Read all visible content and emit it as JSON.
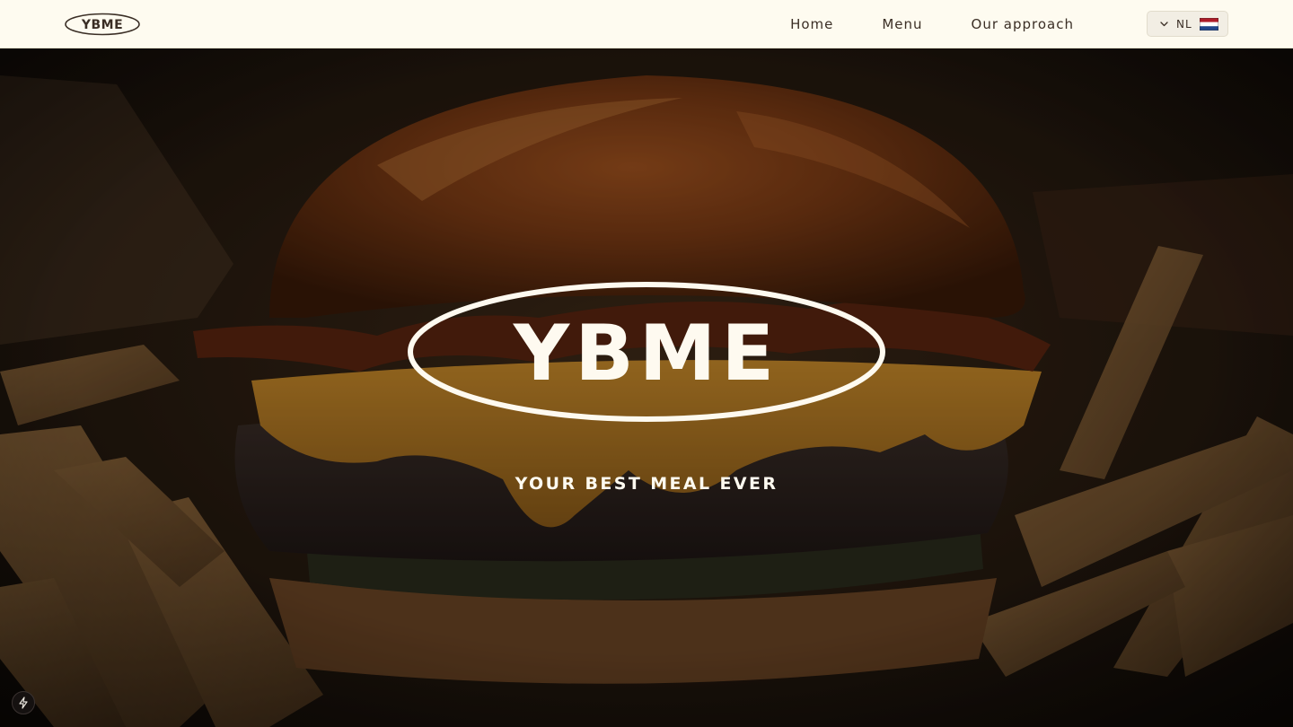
{
  "brand": {
    "name": "YBME",
    "tagline": "YOUR BEST MEAL EVER"
  },
  "nav": {
    "items": [
      {
        "label": "Home"
      },
      {
        "label": "Menu"
      },
      {
        "label": "Our approach"
      }
    ]
  },
  "language": {
    "code": "NL",
    "icon": "chevron-down-icon",
    "flag": "netherlands-flag"
  },
  "dev_badge": {
    "icon": "lightning-bolt-icon"
  },
  "colors": {
    "header_bg": "#fefbf0",
    "text_dark": "#3a2e25",
    "hero_text": "#fefaf0"
  }
}
